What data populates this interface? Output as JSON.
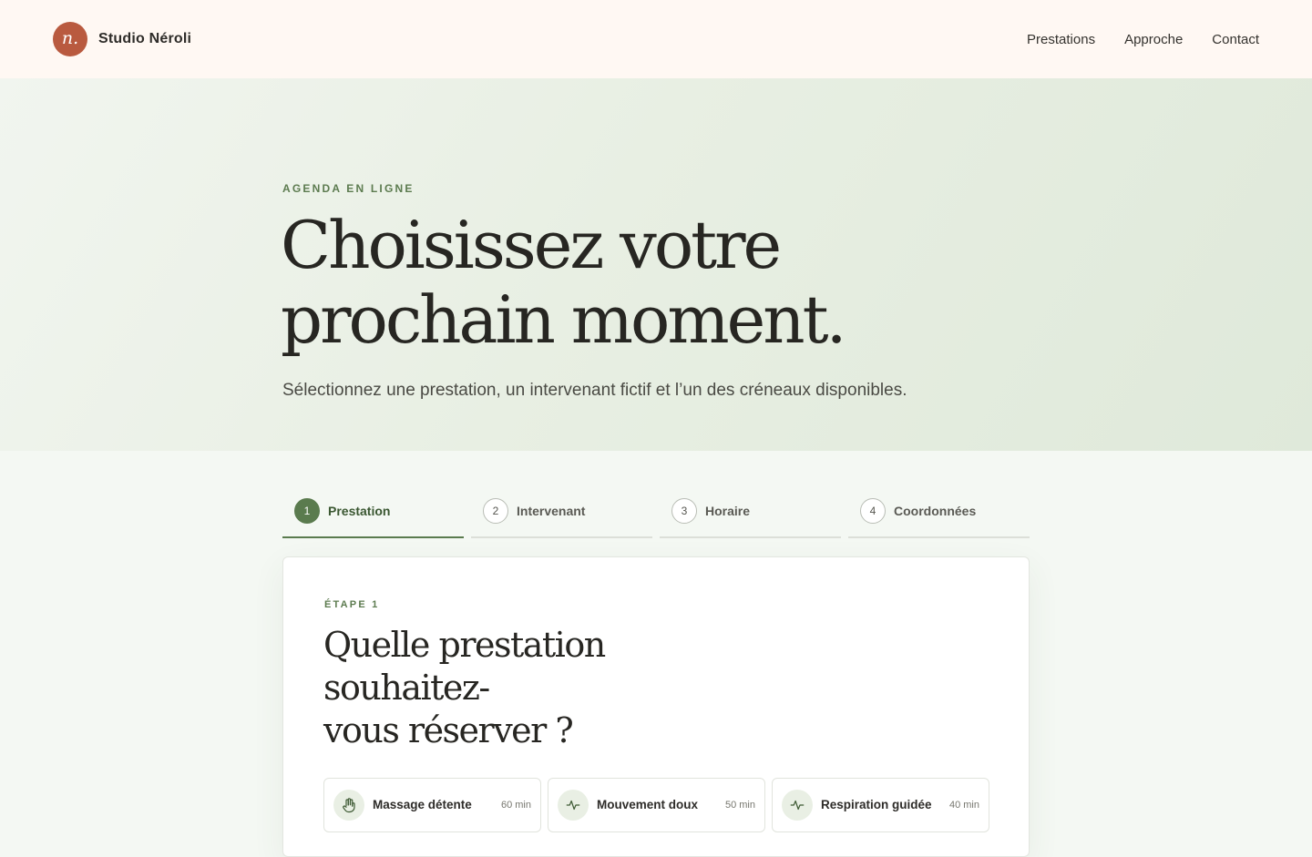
{
  "header": {
    "logo_letter": "n.",
    "brand_name": "Studio Néroli",
    "nav": [
      "Prestations",
      "Approche",
      "Contact"
    ]
  },
  "hero": {
    "eyebrow": "AGENDA EN LIGNE",
    "title_line1": "Choisissez votre",
    "title_line2": "prochain moment.",
    "subtitle": "Sélectionnez une prestation, un intervenant fictif et l’un des créneaux disponibles."
  },
  "stepper": {
    "active_step": 1,
    "steps": [
      {
        "num": "1",
        "label": "Prestation"
      },
      {
        "num": "2",
        "label": "Intervenant"
      },
      {
        "num": "3",
        "label": "Horaire"
      },
      {
        "num": "4",
        "label": "Coordonnées"
      }
    ]
  },
  "card": {
    "eyebrow": "ÉTAPE 1",
    "title_line1": "Quelle prestation",
    "title_line2": "souhaitez-",
    "title_line3": "vous réserver ?",
    "services": [
      {
        "icon": "hand-icon",
        "name": "Massage détente",
        "duration": "60 min"
      },
      {
        "icon": "pulse-icon",
        "name": "Mouvement doux",
        "duration": "50 min"
      },
      {
        "icon": "pulse-icon",
        "name": "Respiration guidée",
        "duration": "40 min"
      }
    ]
  },
  "colors": {
    "accent_green": "#5a7b4e",
    "logo_terracotta": "#b95a3f",
    "header_bg": "#fff8f3"
  }
}
